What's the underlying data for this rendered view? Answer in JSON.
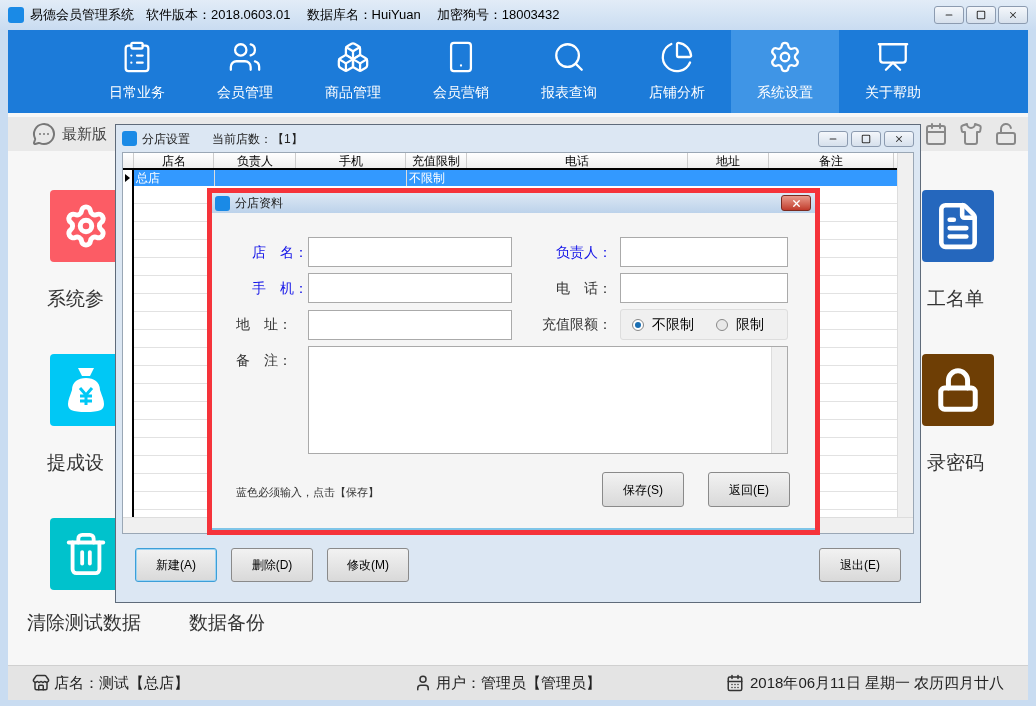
{
  "window": {
    "app_name": "易德会员管理系统",
    "version": "软件版本：2018.0603.01",
    "database": "数据库名：HuiYuan",
    "dongle": "加密狗号：18003432"
  },
  "nav": [
    {
      "label": "日常业务",
      "selected": false
    },
    {
      "label": "会员管理",
      "selected": false
    },
    {
      "label": "商品管理",
      "selected": false
    },
    {
      "label": "会员营销",
      "selected": false
    },
    {
      "label": "报表查询",
      "selected": false
    },
    {
      "label": "店铺分析",
      "selected": false
    },
    {
      "label": "系统设置",
      "selected": true
    },
    {
      "label": "关于帮助",
      "selected": false
    }
  ],
  "toolbar": {
    "notice": "最新版"
  },
  "tiles_left": [
    {
      "label": "系统参",
      "color": "#fc5c65"
    },
    {
      "label": "提成设",
      "color": "#00c8f5"
    },
    {
      "color": "#00c2cc"
    }
  ],
  "tiles_bottom": [
    "清除测试数据",
    "数据备份"
  ],
  "tiles_right": [
    {
      "label": "工名单",
      "color": "#2567bd"
    },
    {
      "label": "录密码",
      "color": "#6e3e05"
    }
  ],
  "branch_window": {
    "title": "分店设置",
    "count": "当前店数：【1】",
    "columns": [
      "店名",
      "负责人",
      "手机",
      "充值限制",
      "电话",
      "地址",
      "备注"
    ],
    "rows": [
      {
        "name": "总店",
        "limit": "不限制",
        "selected": true
      }
    ],
    "buttons": [
      {
        "label": "新建(A)",
        "focused": true
      },
      {
        "label": "删除(D)",
        "focused": false
      },
      {
        "label": "修改(M)",
        "focused": false
      },
      {
        "label": "退出(E)",
        "focused": false
      }
    ]
  },
  "branch_dialog": {
    "title": "分店资料",
    "fields": [
      {
        "label": "店　名：",
        "required": true
      },
      {
        "label": "负责人：",
        "required": true
      },
      {
        "label": "手　机：",
        "required": true
      },
      {
        "label": "电　话：",
        "required": false
      },
      {
        "label": "地　址：",
        "required": false
      }
    ],
    "limit": {
      "label": "充值限额：",
      "options": [
        {
          "label": "不限制",
          "selected": true
        },
        {
          "label": "限制",
          "selected": false
        }
      ]
    },
    "notes": {
      "label": "备　注："
    },
    "hint": "蓝色必须输入，点击【保存】",
    "buttons": [
      "保存(S)",
      "返回(E)"
    ]
  },
  "status_bar": {
    "store": "店名：测试【总店】",
    "user": "用户：管理员【管理员】",
    "date": "2018年06月11日 星期一 农历四月廿八"
  }
}
